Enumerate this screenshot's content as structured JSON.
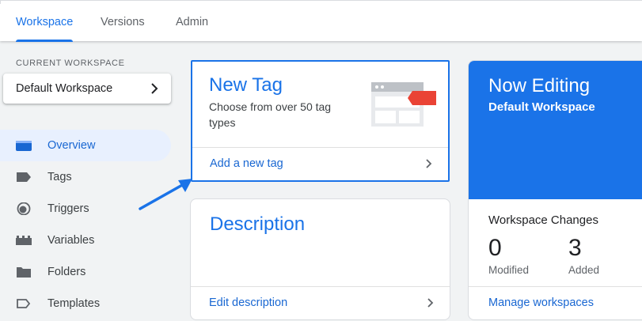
{
  "tabs": [
    {
      "label": "Workspace",
      "active": true
    },
    {
      "label": "Versions",
      "active": false
    },
    {
      "label": "Admin",
      "active": false
    }
  ],
  "sidebar": {
    "current_workspace_label": "CURRENT WORKSPACE",
    "workspace_name": "Default Workspace",
    "items": [
      {
        "label": "Overview",
        "icon": "overview-icon",
        "active": true
      },
      {
        "label": "Tags",
        "icon": "tag-icon",
        "active": false
      },
      {
        "label": "Triggers",
        "icon": "trigger-icon",
        "active": false
      },
      {
        "label": "Variables",
        "icon": "variables-icon",
        "active": false
      },
      {
        "label": "Folders",
        "icon": "folder-icon",
        "active": false
      },
      {
        "label": "Templates",
        "icon": "template-icon",
        "active": false
      }
    ]
  },
  "new_tag_card": {
    "title": "New Tag",
    "subtitle": "Choose from over 50 tag types",
    "link": "Add a new tag"
  },
  "description_card": {
    "title": "Description",
    "link": "Edit description"
  },
  "editing_card": {
    "title": "Now Editing",
    "workspace": "Default Workspace",
    "changes_title": "Workspace Changes",
    "modified_count": "0",
    "modified_label": "Modified",
    "added_count": "3",
    "added_label": "Added",
    "link": "Manage workspaces"
  },
  "colors": {
    "accent": "#1a73e8",
    "active_nav_bg": "#e8f0fe",
    "tag_red": "#ea4335"
  }
}
